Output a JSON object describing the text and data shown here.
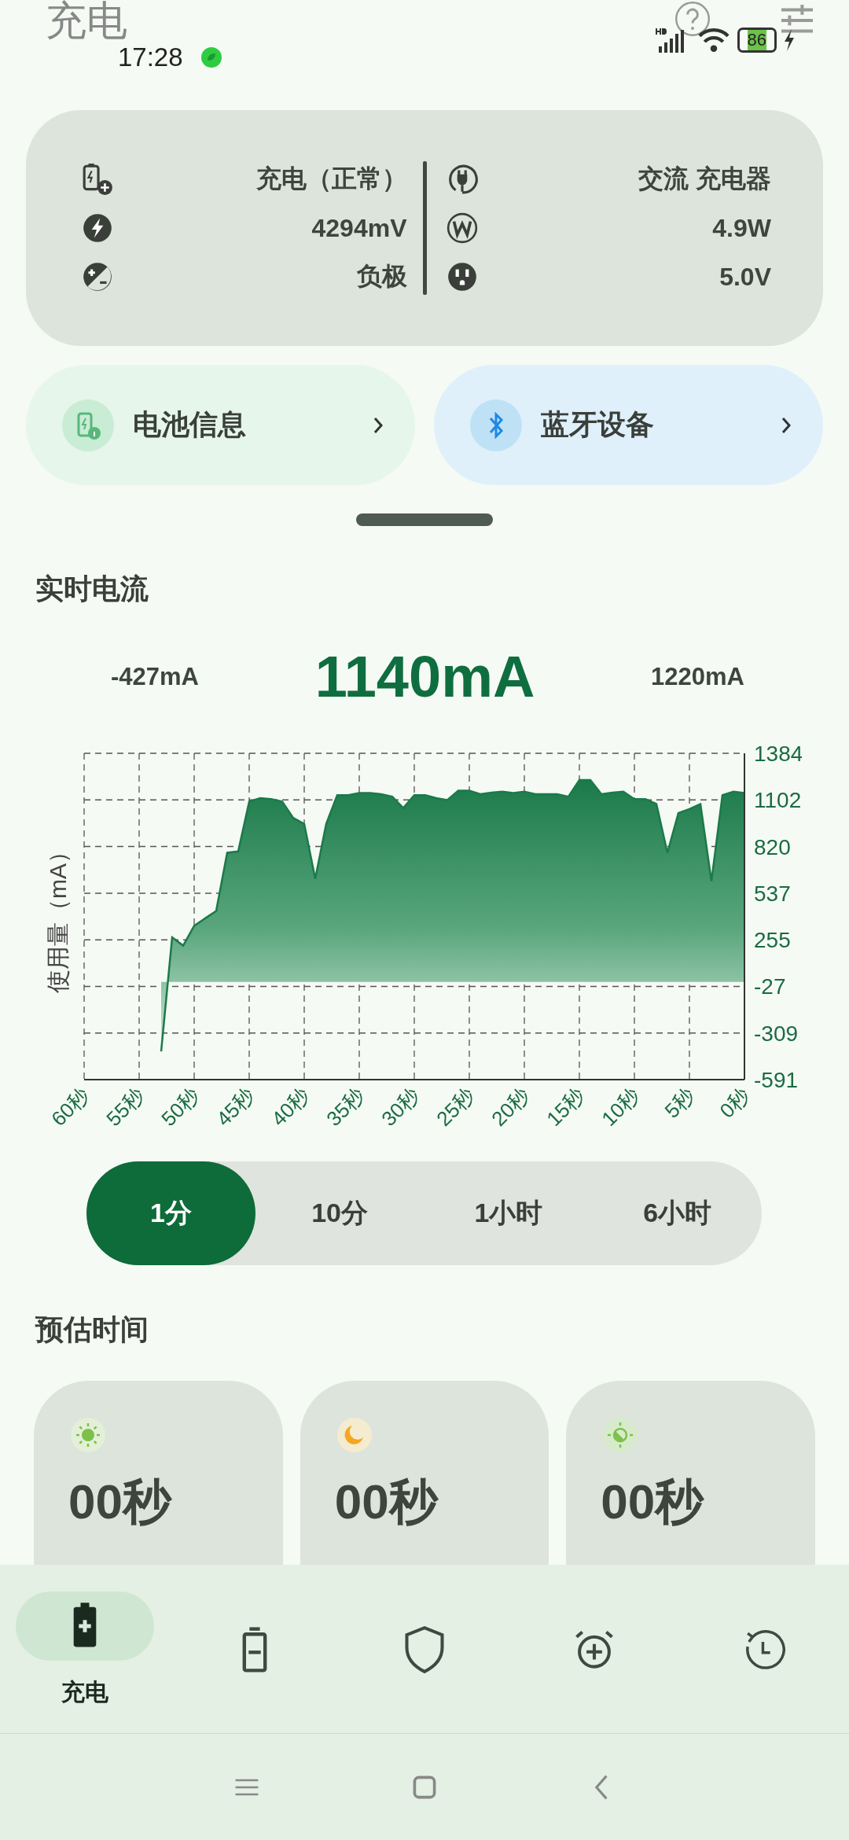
{
  "header": {
    "title": "充电"
  },
  "status_bar": {
    "time": "17:28",
    "battery": "86"
  },
  "info_card": {
    "left": [
      {
        "kind": "charging",
        "value": "充电（正常）"
      },
      {
        "kind": "voltage",
        "value": "4294mV"
      },
      {
        "kind": "polarity",
        "value": "负极"
      }
    ],
    "right": [
      {
        "kind": "plug",
        "value": "交流 充电器"
      },
      {
        "kind": "watt",
        "value": "4.9W"
      },
      {
        "kind": "outlet",
        "value": "5.0V"
      }
    ]
  },
  "shortcuts": [
    {
      "kind": "battery",
      "label": "电池信息"
    },
    {
      "kind": "bluetooth",
      "label": "蓝牙设备"
    }
  ],
  "realtime": {
    "title": "实时电流",
    "min": "-427mA",
    "current": "1140mA",
    "max": "1220mA",
    "chart_data": {
      "type": "area",
      "ylabel": "使用量（mA）",
      "x": [
        53,
        52,
        51,
        50,
        49,
        48,
        47,
        46,
        45,
        44,
        43,
        42,
        41,
        40,
        39,
        38,
        37,
        36,
        35,
        34,
        33,
        32,
        31,
        30,
        29,
        28,
        27,
        26,
        25,
        24,
        23,
        22,
        21,
        20,
        19,
        18,
        17,
        16,
        15,
        14,
        13,
        12,
        11,
        10,
        9,
        8,
        7,
        6,
        5,
        4,
        3,
        2,
        1,
        0
      ],
      "grid": true,
      "series": [
        {
          "color": "#1b7a4a",
          "values": [
            -420,
            270,
            220,
            340,
            385,
            430,
            782,
            790,
            1092,
            1113,
            1107,
            1092,
            993,
            957,
            625,
            957,
            1131,
            1131,
            1143,
            1143,
            1137,
            1122,
            1053,
            1131,
            1131,
            1113,
            1101,
            1158,
            1158,
            1137,
            1146,
            1152,
            1143,
            1152,
            1137,
            1137,
            1137,
            1122,
            1222,
            1222,
            1137,
            1146,
            1152,
            1107,
            1107,
            1077,
            782,
            1023,
            1047,
            1077,
            610,
            1131,
            1152,
            1143
          ]
        }
      ],
      "xlim": [
        60,
        0
      ],
      "ylim": [
        -591,
        1384
      ],
      "xticks": [
        {
          "value": 60,
          "label": "60秒"
        },
        {
          "value": 55,
          "label": "55秒"
        },
        {
          "value": 50,
          "label": "50秒"
        },
        {
          "value": 45,
          "label": "45秒"
        },
        {
          "value": 40,
          "label": "40秒"
        },
        {
          "value": 35,
          "label": "35秒"
        },
        {
          "value": 30,
          "label": "30秒"
        },
        {
          "value": 25,
          "label": "25秒"
        },
        {
          "value": 20,
          "label": "20秒"
        },
        {
          "value": 15,
          "label": "15秒"
        },
        {
          "value": 10,
          "label": "10秒"
        },
        {
          "value": 5,
          "label": "5秒"
        },
        {
          "value": 0,
          "label": "0秒"
        }
      ],
      "yticks": [
        1384,
        1102,
        820,
        537,
        255,
        -27,
        -309,
        -591
      ]
    }
  },
  "ranges": [
    {
      "label": "1分",
      "selected": true
    },
    {
      "label": "10分",
      "selected": false
    },
    {
      "label": "1小时",
      "selected": false
    },
    {
      "label": "6小时",
      "selected": false
    }
  ],
  "estimate": {
    "title": "预估时间",
    "cards": [
      {
        "kind": "screen_on",
        "value": "00秒"
      },
      {
        "kind": "screen_off",
        "value": "00秒"
      },
      {
        "kind": "mixed",
        "value": "00秒"
      }
    ]
  },
  "bottom_nav": [
    {
      "kind": "charge",
      "label": "充电",
      "selected": true
    },
    {
      "kind": "battery",
      "selected": false
    },
    {
      "kind": "shield",
      "selected": false
    },
    {
      "kind": "alarm",
      "selected": false
    },
    {
      "kind": "history",
      "selected": false
    }
  ]
}
